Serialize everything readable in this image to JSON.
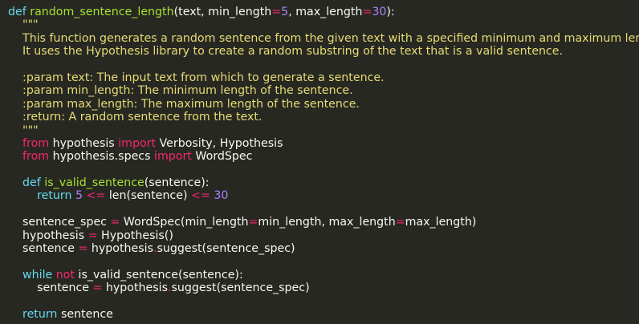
{
  "code_lines": [
    [
      {
        "t": "def",
        "c": "kw"
      },
      {
        "t": " ",
        "c": "txt"
      },
      {
        "t": "random_sentence_length",
        "c": "fn"
      },
      {
        "t": "(text, min_length",
        "c": "txt"
      },
      {
        "t": "=",
        "c": "op"
      },
      {
        "t": "5",
        "c": "num"
      },
      {
        "t": ", max_length",
        "c": "txt"
      },
      {
        "t": "=",
        "c": "op"
      },
      {
        "t": "30",
        "c": "num"
      },
      {
        "t": "):",
        "c": "txt"
      }
    ],
    [
      {
        "t": "    \"\"\"",
        "c": "doc"
      }
    ],
    [
      {
        "t": "    This function generates a random sentence from the given text with a specified minimum and maximum length.",
        "c": "doc"
      }
    ],
    [
      {
        "t": "    It uses the Hypothesis library to create a random substring of the text that is a valid sentence.",
        "c": "doc"
      }
    ],
    [
      {
        "t": "",
        "c": "txt"
      }
    ],
    [
      {
        "t": "    :param text: The input text from which to generate a sentence.",
        "c": "doc"
      }
    ],
    [
      {
        "t": "    :param min_length: The minimum length of the sentence.",
        "c": "doc"
      }
    ],
    [
      {
        "t": "    :param max_length: The maximum length of the sentence.",
        "c": "doc"
      }
    ],
    [
      {
        "t": "    :return: A random sentence from the text.",
        "c": "doc"
      }
    ],
    [
      {
        "t": "    \"\"\"",
        "c": "doc"
      }
    ],
    [
      {
        "t": "    ",
        "c": "txt"
      },
      {
        "t": "from",
        "c": "op"
      },
      {
        "t": " hypothesis ",
        "c": "txt"
      },
      {
        "t": "import",
        "c": "op"
      },
      {
        "t": " Verbosity, Hypothesis",
        "c": "txt"
      }
    ],
    [
      {
        "t": "    ",
        "c": "txt"
      },
      {
        "t": "from",
        "c": "op"
      },
      {
        "t": " hypothesis.specs ",
        "c": "txt"
      },
      {
        "t": "import",
        "c": "op"
      },
      {
        "t": " WordSpec",
        "c": "txt"
      }
    ],
    [
      {
        "t": "",
        "c": "txt"
      }
    ],
    [
      {
        "t": "    ",
        "c": "txt"
      },
      {
        "t": "def",
        "c": "kw"
      },
      {
        "t": " ",
        "c": "txt"
      },
      {
        "t": "is_valid_sentence",
        "c": "fn"
      },
      {
        "t": "(sentence):",
        "c": "txt"
      }
    ],
    [
      {
        "t": "        ",
        "c": "txt"
      },
      {
        "t": "return",
        "c": "kw"
      },
      {
        "t": " ",
        "c": "txt"
      },
      {
        "t": "5",
        "c": "num"
      },
      {
        "t": " ",
        "c": "txt"
      },
      {
        "t": "<=",
        "c": "op"
      },
      {
        "t": " len(sentence) ",
        "c": "txt"
      },
      {
        "t": "<=",
        "c": "op"
      },
      {
        "t": " ",
        "c": "txt"
      },
      {
        "t": "30",
        "c": "num"
      }
    ],
    [
      {
        "t": "",
        "c": "txt"
      }
    ],
    [
      {
        "t": "    sentence_spec ",
        "c": "txt"
      },
      {
        "t": "=",
        "c": "op"
      },
      {
        "t": " WordSpec(min_length",
        "c": "txt"
      },
      {
        "t": "=",
        "c": "op"
      },
      {
        "t": "min_length, max_length",
        "c": "txt"
      },
      {
        "t": "=",
        "c": "op"
      },
      {
        "t": "max_length)",
        "c": "txt"
      }
    ],
    [
      {
        "t": "    hypothesis ",
        "c": "txt"
      },
      {
        "t": "=",
        "c": "op"
      },
      {
        "t": " Hypothesis()",
        "c": "txt"
      }
    ],
    [
      {
        "t": "    sentence ",
        "c": "txt"
      },
      {
        "t": "=",
        "c": "op"
      },
      {
        "t": " hypothesis",
        "c": "txt"
      },
      {
        "t": ".",
        "c": "op"
      },
      {
        "t": "suggest(sentence_spec)",
        "c": "txt"
      }
    ],
    [
      {
        "t": "",
        "c": "txt"
      }
    ],
    [
      {
        "t": "    ",
        "c": "txt"
      },
      {
        "t": "while",
        "c": "kw"
      },
      {
        "t": " ",
        "c": "txt"
      },
      {
        "t": "not",
        "c": "op"
      },
      {
        "t": " is_valid_sentence(sentence):",
        "c": "txt"
      }
    ],
    [
      {
        "t": "        sentence ",
        "c": "txt"
      },
      {
        "t": "=",
        "c": "op"
      },
      {
        "t": " hypothesis",
        "c": "txt"
      },
      {
        "t": ".",
        "c": "op"
      },
      {
        "t": "suggest(sentence_spec)",
        "c": "txt"
      }
    ],
    [
      {
        "t": "",
        "c": "txt"
      }
    ],
    [
      {
        "t": "    ",
        "c": "txt"
      },
      {
        "t": "return",
        "c": "kw"
      },
      {
        "t": " sentence",
        "c": "txt"
      }
    ]
  ]
}
